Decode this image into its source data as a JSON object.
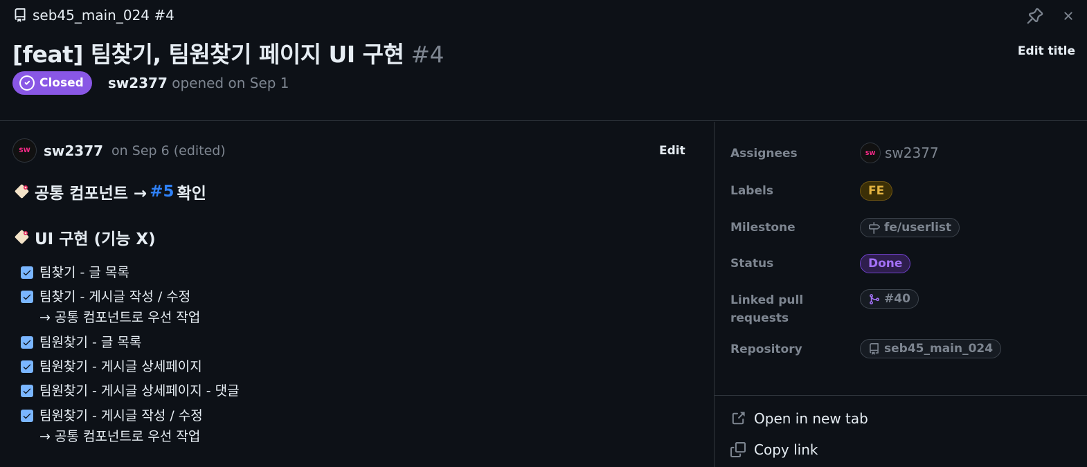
{
  "header": {
    "repo_label": "seb45_main_024 #4",
    "title": "[feat] 팀찾기, 팀원찾기 페이지 UI 구현",
    "number": "#4",
    "edit_title_label": "Edit title",
    "state_label": "Closed",
    "author": "sw2377",
    "opened_text": "opened on Sep 1",
    "icons": [
      "repo-icon",
      "pin-icon",
      "close-icon"
    ]
  },
  "comment": {
    "avatar_text": "SW",
    "author": "sw2377",
    "meta": "on Sep 6 (edited)",
    "edit_label": "Edit",
    "heading1": {
      "before": "공통 컴포넌트 →",
      "link": "#5",
      "after": "확인"
    },
    "heading2": "UI 구현 (기능 X)",
    "tasks": [
      {
        "text": "팀찾기 - 글 목록",
        "sub": ""
      },
      {
        "text": "팀찾기 - 게시글 작성 / 수정",
        "sub": "→ 공통 컴포넌트로 우선 작업"
      },
      {
        "text": "팀원찾기 - 글 목록",
        "sub": ""
      },
      {
        "text": "팀원찾기 - 게시글 상세페이지",
        "sub": ""
      },
      {
        "text": "팀원찾기 - 게시글 상세페이지 - 댓글",
        "sub": ""
      },
      {
        "text": "팀원찾기 - 게시글 작성 / 수정",
        "sub": "→ 공통 컴포넌트로 우선 작업"
      }
    ]
  },
  "sidebar": {
    "assignees_label": "Assignees",
    "assignee": "sw2377",
    "labels_label": "Labels",
    "label_value": "FE",
    "milestone_label": "Milestone",
    "milestone_value": "fe/userlist",
    "status_label": "Status",
    "status_value": "Done",
    "linked_label": "Linked pull requests",
    "linked_value": "#40",
    "repository_label": "Repository",
    "repository_value": "seb45_main_024",
    "open_new_tab": "Open in new tab",
    "copy_link": "Copy link"
  },
  "colors": {
    "closed_badge": "#8957e5",
    "label_fe_bg": "#3b2f06",
    "label_fe_text": "#e3b341",
    "status_done_bg": "#2e1e4d",
    "status_done_text": "#a371f7",
    "link": "#2f81f7"
  }
}
